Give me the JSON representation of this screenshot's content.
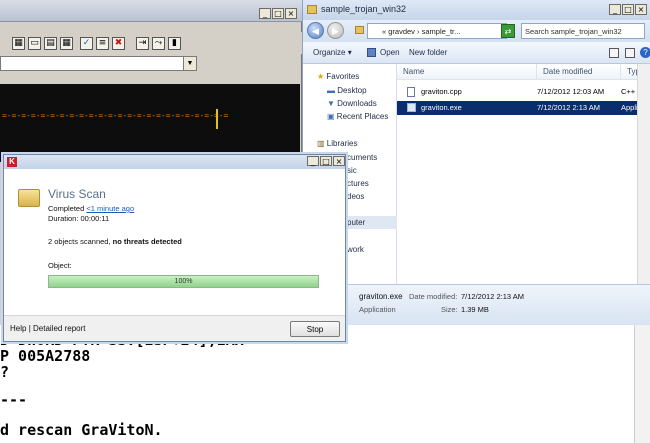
{
  "debugger": {
    "dash_line": "=-=-=-=-=-=-=-=-=-=-=-=-=-=-=-=-=-=-=-=-=-=-=-=-=-=-=-=-=-=//"
  },
  "explorer": {
    "title": "sample_trojan_win32",
    "address": "« gravdev › sample_tr...",
    "search_placeholder": "Search sample_trojan_win32",
    "commands": {
      "organize": "Organize",
      "open": "Open",
      "new_folder": "New folder"
    },
    "nav": {
      "favorites": "Favorites",
      "desktop": "Desktop",
      "downloads": "Downloads",
      "recent": "Recent Places",
      "libraries": "Libraries",
      "documents": "cuments",
      "music": "sic",
      "pictures": "ctures",
      "videos": "deos",
      "computer": "puter",
      "network": "work"
    },
    "columns": {
      "name": "Name",
      "date": "Date modified",
      "type": "Type"
    },
    "files": [
      {
        "name": "graviton.cpp",
        "date": "7/12/2012 12:03 AM",
        "type": "C++ Sou"
      },
      {
        "name": "graviton.exe",
        "date": "7/12/2012 2:13 AM",
        "type": "Applicatio"
      }
    ],
    "details": {
      "name": "graviton.exe",
      "date_label": "Date modified:",
      "date_value": "7/12/2012 2:13 AM",
      "type": "Application",
      "size_label": "Size:",
      "size_value": "1.39 MB"
    }
  },
  "terminal": {
    "lines": [
      "D DWORD PTR SS:[ESP+24],EAX",
      "P 005A2788",
      "?",
      "---",
      "d rescan GraVitoN."
    ]
  },
  "scan": {
    "heading": "Virus Scan",
    "status": "Completed",
    "time_link": "<1 minute ago",
    "duration": "Duration: 00:00:11",
    "summary_prefix": "2 objects scanned, ",
    "summary_bold": "no threats detected",
    "object_label": "Object:",
    "progress_percent": 100,
    "progress_text": "100%",
    "help": "Help",
    "separator": "|",
    "detailed_report": "Detailed report",
    "stop": "Stop"
  }
}
